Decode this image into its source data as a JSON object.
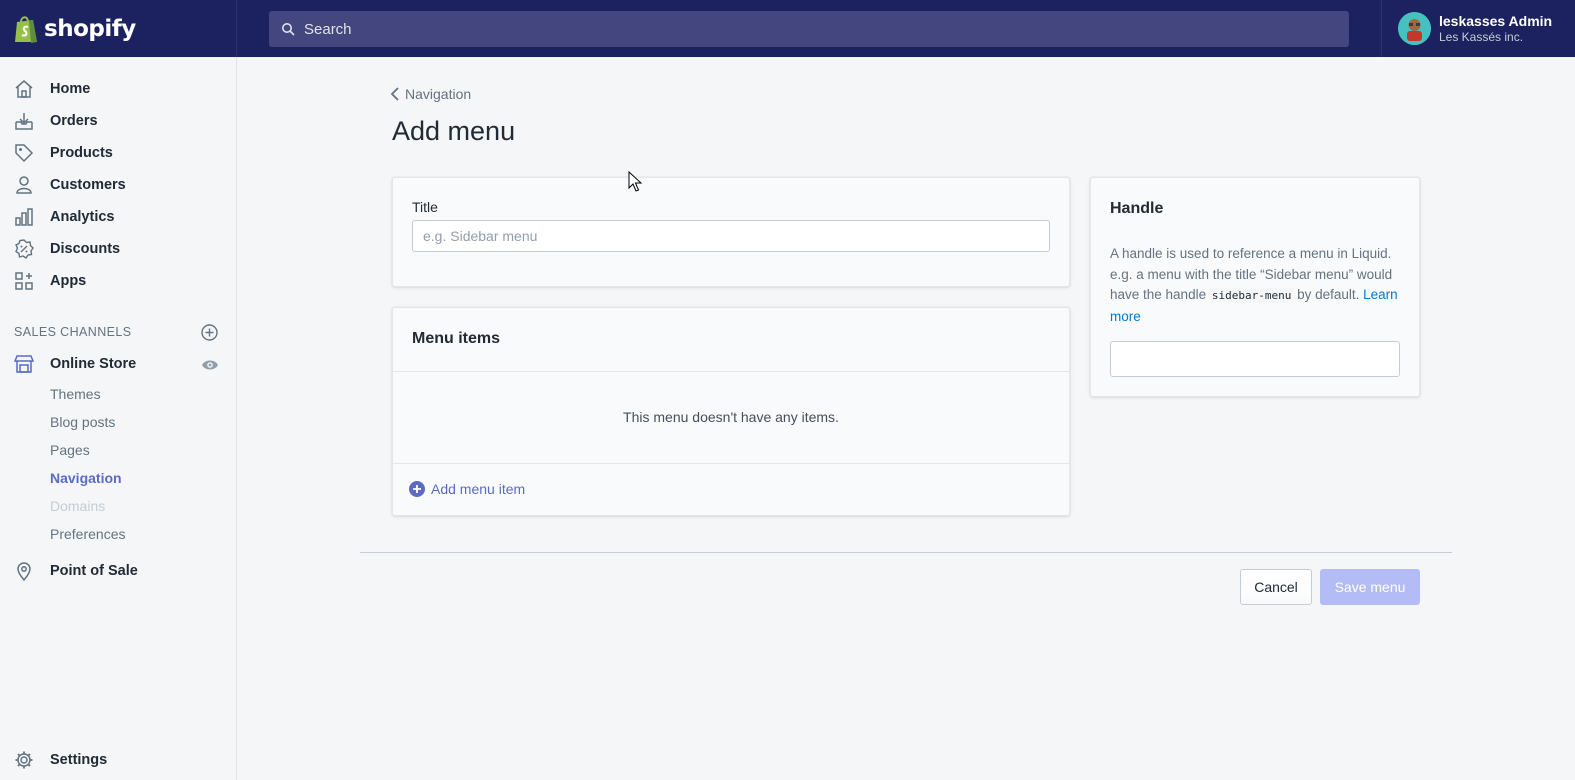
{
  "brand": {
    "name": "shopify",
    "accent": "#5c6ac4",
    "topbar_color": "#1c2260"
  },
  "search": {
    "placeholder": "Search"
  },
  "account": {
    "name": "leskasses Admin",
    "store": "Les Kassés inc."
  },
  "sidebar": {
    "items": [
      {
        "label": "Home",
        "icon": "home-icon"
      },
      {
        "label": "Orders",
        "icon": "orders-icon"
      },
      {
        "label": "Products",
        "icon": "tag-icon"
      },
      {
        "label": "Customers",
        "icon": "person-icon"
      },
      {
        "label": "Analytics",
        "icon": "bar-chart-icon"
      },
      {
        "label": "Discounts",
        "icon": "discount-icon"
      },
      {
        "label": "Apps",
        "icon": "apps-icon"
      }
    ],
    "sales_channels_label": "SALES CHANNELS",
    "online_store": {
      "label": "Online Store",
      "sub_items": [
        {
          "label": "Themes",
          "state": "normal"
        },
        {
          "label": "Blog posts",
          "state": "normal"
        },
        {
          "label": "Pages",
          "state": "normal"
        },
        {
          "label": "Navigation",
          "state": "active"
        },
        {
          "label": "Domains",
          "state": "disabled"
        },
        {
          "label": "Preferences",
          "state": "normal"
        }
      ]
    },
    "point_of_sale": "Point of Sale",
    "settings": "Settings"
  },
  "main": {
    "breadcrumb": "Navigation",
    "title": "Add menu",
    "title_card": {
      "label": "Title",
      "placeholder": "e.g. Sidebar menu"
    },
    "menu_items_card": {
      "heading": "Menu items",
      "empty_text": "This menu doesn't have any items.",
      "add_label": "Add menu item"
    },
    "handle_card": {
      "heading": "Handle",
      "desc_part1": "A handle is used to reference a menu in Liquid. e.g. a menu with the title “Sidebar menu” would have the handle ",
      "desc_code": "sidebar-menu",
      "desc_part2": " by default. ",
      "learn_more": "Learn more",
      "value": ""
    },
    "actions": {
      "cancel": "Cancel",
      "save": "Save menu"
    }
  }
}
